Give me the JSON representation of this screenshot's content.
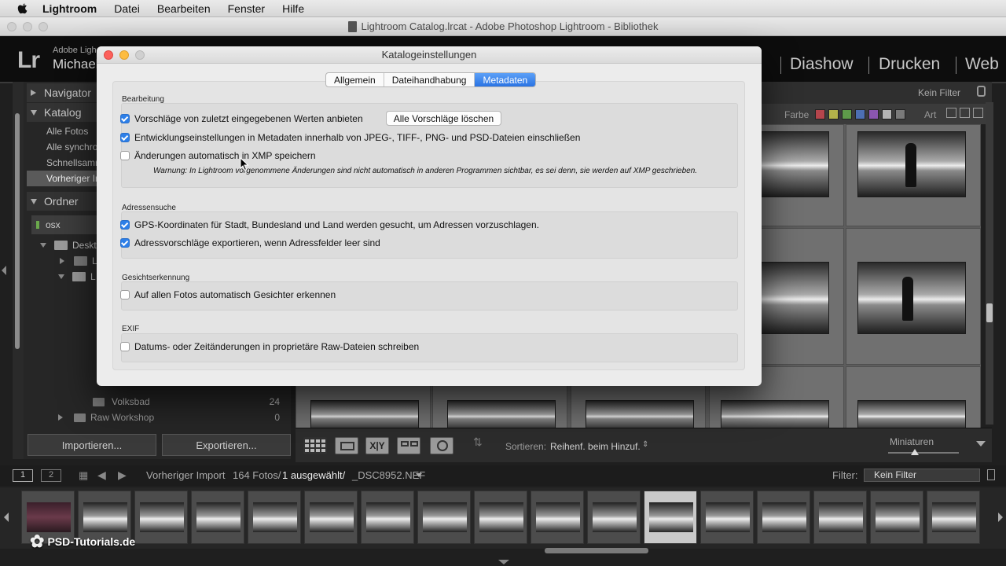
{
  "menubar": {
    "items": [
      "Lightroom",
      "Datei",
      "Bearbeiten",
      "Fenster",
      "Hilfe"
    ]
  },
  "window": {
    "title": "Lightroom Catalog.lrcat - Adobe Photoshop Lightroom - Bibliothek"
  },
  "identity": {
    "logo": "Lr",
    "line1": "Adobe Ligh",
    "line2": "Michael"
  },
  "modules": [
    "Diashow",
    "Drucken",
    "Web"
  ],
  "left": {
    "navigator": "Navigator",
    "catalog": "Katalog",
    "catalog_items": [
      "Alle Fotos",
      "Alle synchro",
      "Schnellsamr",
      "Vorheriger In"
    ],
    "folders": "Ordner",
    "volume": "osx",
    "folder_rows": [
      {
        "name": "Deskt",
        "count": ""
      },
      {
        "name": "L",
        "count": ""
      },
      {
        "name": "L",
        "count": ""
      },
      {
        "name": "Volksbad",
        "count": "24"
      },
      {
        "name": "Raw Workshop",
        "count": "0"
      }
    ],
    "import_label": "Importieren...",
    "export_label": "Exportieren..."
  },
  "filterbar": {
    "no_filter": "Kein Filter",
    "color_label": "Farbe",
    "kind_label": "Art"
  },
  "colors": {
    "swatches": [
      "#b5454c",
      "#b3b24a",
      "#5e9a4a",
      "#4d6fb3",
      "#8a56b0",
      "#b5b5b5",
      "#7a7a7a"
    ]
  },
  "toolbar": {
    "sort_label": "Sortieren:",
    "sort_value": "Reihenf. beim Hinzuf.",
    "thumbs_label": "Miniaturen"
  },
  "filmbar": {
    "source": "Vorheriger Import",
    "count": "164 Fotos/",
    "selected": "1 ausgewählt/",
    "file": "_DSC8952.NEF",
    "filter_label": "Filter:",
    "filter_value": "Kein Filter",
    "page1": "1",
    "page2": "2"
  },
  "watermark": "PSD-Tutorials.de",
  "dialog": {
    "title": "Katalogeinstellungen",
    "tabs": [
      "Allgemein",
      "Dateihandhabung",
      "Metadaten"
    ],
    "active_tab": "Metadaten",
    "sections": {
      "editing": "Bearbeitung",
      "address": "Adressensuche",
      "faces": "Gesichtserkennung",
      "exif": "EXIF"
    },
    "opt_suggestions": "Vorschläge von zuletzt eingegebenen Werten anbieten",
    "clear_button": "Alle Vorschläge löschen",
    "opt_develop": "Entwicklungseinstellungen in Metadaten innerhalb von JPEG-, TIFF-, PNG- und PSD-Dateien einschließen",
    "opt_xmp": "Änderungen automatisch in XMP speichern",
    "warning": "Warnung: In Lightroom vorgenommene Änderungen sind nicht automatisch in anderen Programmen sichtbar, es sei denn, sie werden auf XMP geschrieben.",
    "opt_gps": "GPS-Koordinaten für Stadt, Bundesland und Land werden gesucht, um Adressen vorzuschlagen.",
    "opt_addr": "Adressvorschläge exportieren, wenn Adressfelder leer sind",
    "opt_faces": "Auf allen Fotos automatisch Gesichter erkennen",
    "opt_exif": "Datums- oder Zeitänderungen in proprietäre Raw-Dateien schreiben"
  }
}
